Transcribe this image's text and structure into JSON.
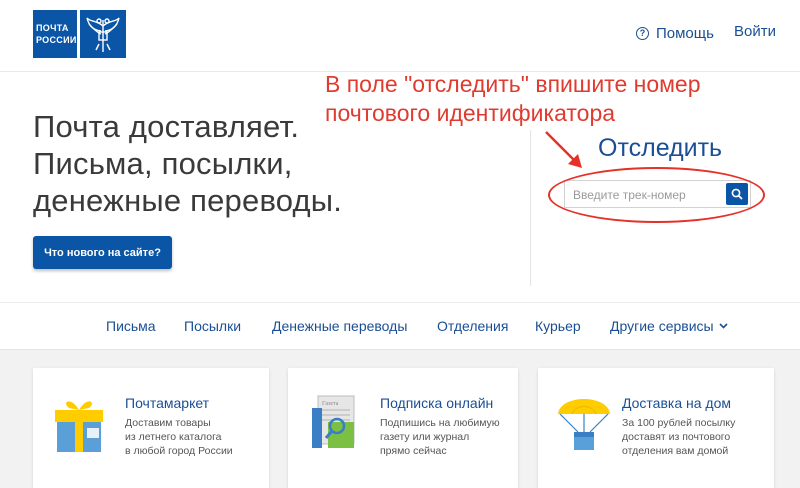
{
  "header": {
    "logo_line1": "ПОЧТА",
    "logo_line2": "РОССИИ",
    "help_icon_glyph": "?",
    "help_label": "Помощь",
    "login_label": "Войти"
  },
  "hero": {
    "lines": [
      "Почта доставляет.",
      "Письма, посылки,",
      "денежные переводы."
    ],
    "news_button": "Что нового на сайте?"
  },
  "annotation": {
    "lines": [
      "В поле \"отследить\" впишите номер",
      "почтового идентификатора"
    ],
    "color": "#e53127"
  },
  "track": {
    "title": "Отследить",
    "placeholder": "Введите трек-номер",
    "value": ""
  },
  "nav": {
    "items": [
      "Письма",
      "Посылки",
      "Денежные переводы",
      "Отделения",
      "Курьер",
      "Другие сервисы"
    ]
  },
  "cards": [
    {
      "title": "Почтамаркет",
      "desc": [
        "Доставим товары",
        "из летнего каталога",
        "в любой город России"
      ],
      "icon": "gift-box-icon"
    },
    {
      "title": "Подписка онлайн",
      "desc": [
        "Подпишись на любимую",
        "газету или журнал",
        "прямо сейчас"
      ],
      "icon": "newspaper-icon",
      "newspaper_text": "Газета"
    },
    {
      "title": "Доставка на дом",
      "desc": [
        "За 100 рублей посылку",
        "доставят из почтового",
        "отделения вам домой"
      ],
      "icon": "parachute-box-icon"
    }
  ],
  "colors": {
    "brand": "#0a55a5",
    "link": "#1a4f95",
    "accent_yellow": "#ffcc00"
  }
}
